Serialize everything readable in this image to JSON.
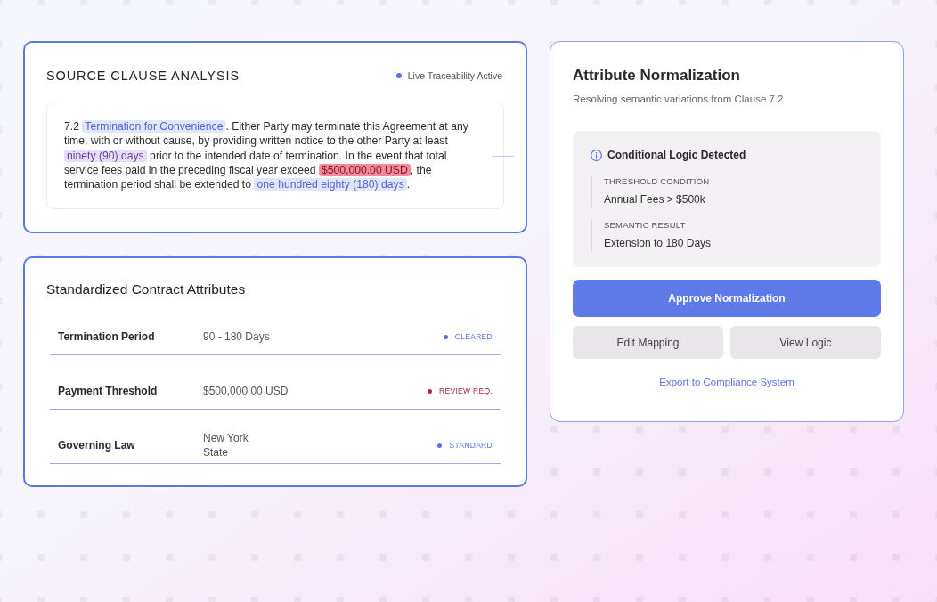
{
  "clause_panel": {
    "title": "SOURCE CLAUSE ANALYSIS",
    "live_status": "Live Traceability Active",
    "clause": [
      {
        "kind": "plain",
        "text": "7.2 "
      },
      {
        "kind": "mapped",
        "text": "Termination for Convenience"
      },
      {
        "kind": "plain",
        "text": ". Either Party may terminate this Agreement at any time, with or without cause, by providing written notice to the other Party at least "
      },
      {
        "kind": "source",
        "text": "ninety (90) days"
      },
      {
        "kind": "plain",
        "text": " prior to the intended date of termination. In the event that total service fees paid in the preceding fiscal year exceed "
      },
      {
        "kind": "flagged",
        "text": "$500,000.00 USD"
      },
      {
        "kind": "plain",
        "text": ", the termination period shall be extended to "
      },
      {
        "kind": "mapped",
        "text": "one hundred eighty (180) days"
      },
      {
        "kind": "plain",
        "text": "."
      }
    ]
  },
  "attributes_panel": {
    "title": "Standardized Contract Attributes",
    "rows": [
      {
        "label": "Termination Period",
        "value": "90 - 180 Days",
        "status": "CLEARED",
        "color": "#5b72e6"
      },
      {
        "label": "Payment Threshold",
        "value": "$500,000.00 USD",
        "status": "REVIEW REQ.",
        "color": "#a32a43"
      },
      {
        "label": "Governing Law",
        "value": "New York\nState",
        "status": "STANDARD",
        "color": "#5b72e6"
      }
    ]
  },
  "normalization_panel": {
    "title": "Attribute Normalization",
    "subtitle": "Resolving semantic variations from Clause 7.2",
    "logic": {
      "title": "Conditional Logic Detected",
      "items": [
        {
          "label": "THRESHOLD CONDITION",
          "value": "Annual Fees > $500k"
        },
        {
          "label": "SEMANTIC RESULT",
          "value": "Extension to 180 Days"
        }
      ]
    },
    "primary_button": "Approve Normalization",
    "secondary_buttons": [
      "Edit Mapping",
      "View Logic"
    ],
    "link": "Export to Compliance System"
  }
}
